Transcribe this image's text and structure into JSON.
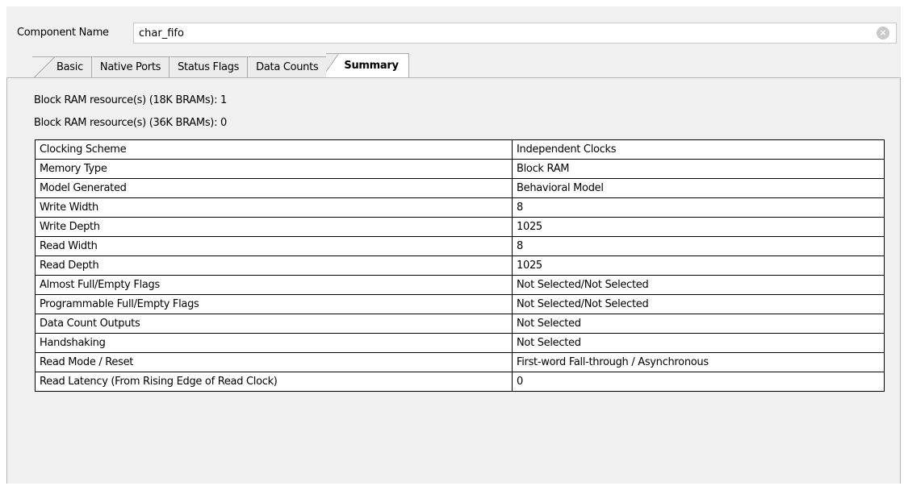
{
  "component": {
    "label": "Component Name",
    "value": "char_fifo"
  },
  "tabs": [
    {
      "label": "Basic"
    },
    {
      "label": "Native Ports"
    },
    {
      "label": "Status Flags"
    },
    {
      "label": "Data Counts"
    },
    {
      "label": "Summary"
    }
  ],
  "active_tab": "Summary",
  "summary": {
    "bram18": "Block RAM resource(s) (18K BRAMs): 1",
    "bram36": "Block RAM resource(s) (36K BRAMs): 0",
    "rows": [
      {
        "key": "Clocking Scheme",
        "value": "Independent Clocks"
      },
      {
        "key": "Memory Type",
        "value": "Block RAM"
      },
      {
        "key": "Model Generated",
        "value": "Behavioral Model"
      },
      {
        "key": "Write Width",
        "value": "8"
      },
      {
        "key": "Write Depth",
        "value": "1025"
      },
      {
        "key": "Read Width",
        "value": "8"
      },
      {
        "key": "Read Depth",
        "value": "1025"
      },
      {
        "key": "Almost Full/Empty Flags",
        "value": "Not Selected/Not Selected"
      },
      {
        "key": "Programmable Full/Empty Flags",
        "value": "Not Selected/Not Selected"
      },
      {
        "key": "Data Count Outputs",
        "value": "Not Selected"
      },
      {
        "key": "Handshaking",
        "value": "Not Selected"
      },
      {
        "key": "Read Mode / Reset",
        "value": "First-word Fall-through / Asynchronous"
      },
      {
        "key": "Read Latency (From Rising Edge of Read Clock)",
        "value": "0"
      }
    ]
  },
  "icons": {
    "clear": "clear-icon"
  }
}
